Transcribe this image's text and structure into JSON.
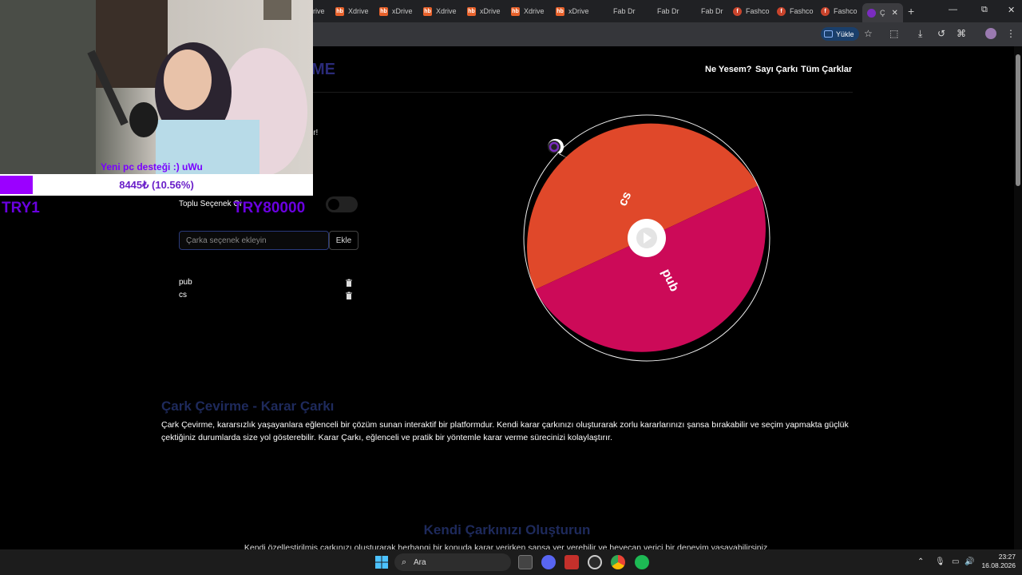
{
  "browser": {
    "tabs": [
      {
        "label": "rive",
        "icon": "none"
      },
      {
        "label": "Xdrive",
        "icon": "hb-icon"
      },
      {
        "label": "xDrive",
        "icon": "hb-icon"
      },
      {
        "label": "Xdrive",
        "icon": "hb-icon"
      },
      {
        "label": "xDrive",
        "icon": "hb-icon"
      },
      {
        "label": "Xdrive",
        "icon": "hb-icon"
      },
      {
        "label": "xDrive",
        "icon": "hb-icon"
      },
      {
        "label": "Fab Dr",
        "icon": "fab-icon"
      },
      {
        "label": "Fab Dr",
        "icon": "fab-icon"
      },
      {
        "label": "Fab Dr",
        "icon": "fab-icon"
      },
      {
        "label": "Fashco",
        "icon": "fashco-icon"
      },
      {
        "label": "Fashco",
        "icon": "fashco-icon"
      },
      {
        "label": "Fashco",
        "icon": "fashco-icon"
      }
    ],
    "active_tab": "Ç",
    "new_tab": "+",
    "update_button": "Yükle"
  },
  "site": {
    "logo": "ME",
    "nav": [
      "Ne Yesem?",
      "Sayı Çarkı",
      "Tüm Çarklar"
    ],
    "hero_fragment": "ir!",
    "bulk_label": "Toplu Seçenek Gi",
    "add_placeholder": "Çarka seçenek ekleyin",
    "add_button": "Ekle",
    "options": [
      "pub",
      "cs"
    ],
    "about_title": "Çark Çevirme - Karar Çarkı",
    "about_text": "Çark Çevirme, kararsızlık yaşayanlara eğlenceli bir çözüm sunan interaktif bir platformdur. Kendi karar çarkınızı oluşturarak zorlu kararlarınızı şansa bırakabilir ve seçim yapmakta güçlük çektiğiniz durumlarda size yol gösterebilir. Karar Çarkı, eğlenceli ve pratik bir yöntemle karar verme sürecinizi kolaylaştırır.",
    "create_title": "Kendi Çarkınızı Oluşturun",
    "create_text": "Kendi özelleştirilmiş çarkınızı oluşturarak herhangi bir konuda karar verirken şansa yer verebilir ve heyecan verici bir deneyim yaşayabilirsiniz."
  },
  "wheel": {
    "segments": [
      {
        "label": "cs",
        "color": "#e0482a"
      },
      {
        "label": "pub",
        "color": "#cc0a58"
      }
    ]
  },
  "stream_overlay": {
    "donation_message": "Yeni pc desteği :) uWu",
    "donation_amount": "8445₺ (10.56%)",
    "donation_progress": 0.1056,
    "goal_left": "TRY1",
    "goal_right": "TRY80000"
  },
  "taskbar": {
    "search_placeholder": "Ara",
    "time": "23:27",
    "date": "16.08.2026"
  },
  "colors": {
    "accent_purple": "#9b00ff",
    "wheel_orange": "#e0482a",
    "wheel_pink": "#cc0a58"
  }
}
